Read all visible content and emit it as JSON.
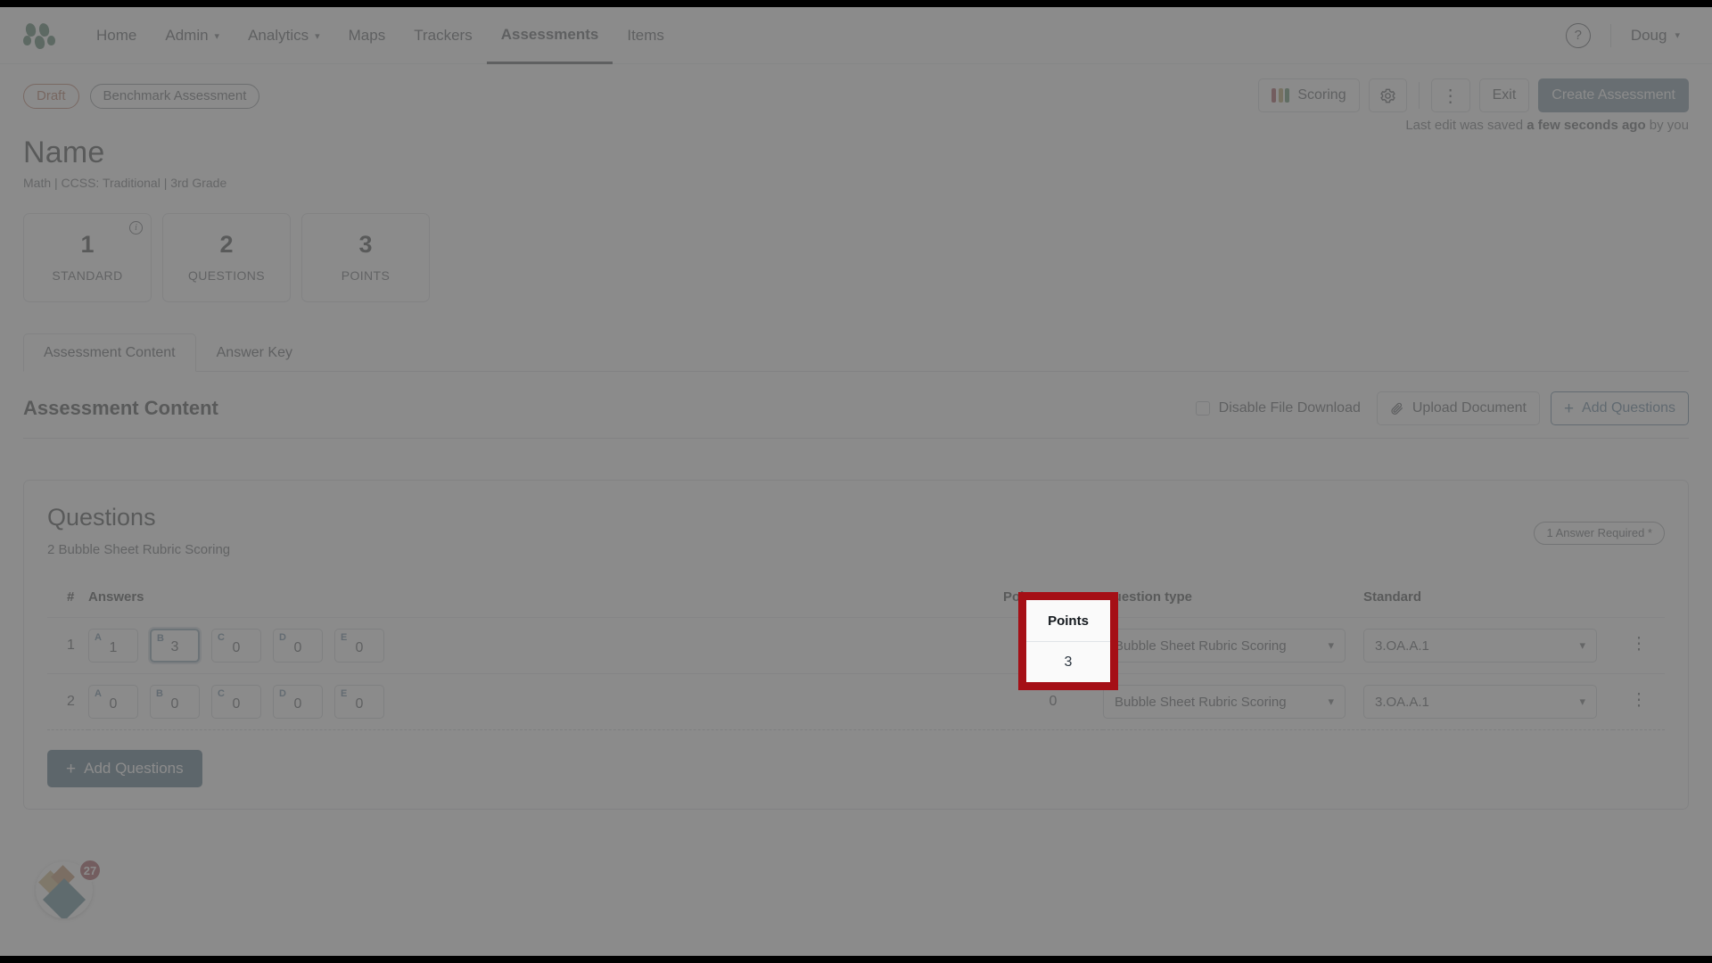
{
  "nav": {
    "logo_icon": "scantron-dots-logo",
    "items": [
      {
        "label": "Home",
        "has_caret": false,
        "active": false
      },
      {
        "label": "Admin",
        "has_caret": true,
        "active": false
      },
      {
        "label": "Analytics",
        "has_caret": true,
        "active": false
      },
      {
        "label": "Maps",
        "has_caret": false,
        "active": false
      },
      {
        "label": "Trackers",
        "has_caret": false,
        "active": false
      },
      {
        "label": "Assessments",
        "has_caret": false,
        "active": true
      },
      {
        "label": "Items",
        "has_caret": false,
        "active": false
      }
    ],
    "help_label": "?",
    "user_label": "Doug",
    "caret_glyph": "⌄"
  },
  "header": {
    "status_chip": "Draft",
    "type_chip": "Benchmark Assessment",
    "title": "Name",
    "subtitle": "Math  |  CCSS: Traditional  |  3rd Grade",
    "saved_prefix": "Last edit was saved ",
    "saved_strong": "a few seconds ago",
    "saved_suffix": " by you",
    "actions": {
      "scoring_label": "Scoring",
      "settings_icon": "gear-icon",
      "kebab_icon": "vertical-dots-icon",
      "exit_label": "Exit",
      "create_label": "Create Assessment"
    },
    "scoring_colors": [
      "#c01928",
      "#b3880f",
      "#1b7a33"
    ]
  },
  "stats": [
    {
      "number": "1",
      "label": "STANDARD",
      "info": true
    },
    {
      "number": "2",
      "label": "QUESTIONS",
      "info": false
    },
    {
      "number": "3",
      "label": "POINTS",
      "info": false
    }
  ],
  "tabs": [
    {
      "label": "Assessment Content",
      "active": true
    },
    {
      "label": "Answer Key",
      "active": false
    }
  ],
  "section": {
    "title": "Assessment Content",
    "disable_download_label": "Disable File Download",
    "disable_download_checked": false,
    "upload_label": "Upload Document",
    "upload_icon": "paperclip-icon",
    "add_questions_label": "Add Questions",
    "plus_icon": "plus-icon"
  },
  "questions_card": {
    "title": "Questions",
    "subtitle": "2 Bubble Sheet Rubric Scoring",
    "requirement_badge": "1 Answer Required *",
    "columns": {
      "number": "#",
      "answers": "Answers",
      "points": "Points",
      "question_type": "Question type",
      "standard": "Standard"
    },
    "rows": [
      {
        "number": "1",
        "answers": [
          {
            "letter": "A",
            "value": "1",
            "focused": false
          },
          {
            "letter": "B",
            "value": "3",
            "focused": true
          },
          {
            "letter": "C",
            "value": "0",
            "focused": false
          },
          {
            "letter": "D",
            "value": "0",
            "focused": false
          },
          {
            "letter": "E",
            "value": "0",
            "focused": false
          }
        ],
        "points": "3",
        "question_type": "Bubble Sheet Rubric Scoring",
        "standard": "3.OA.A.1",
        "menu_icon": "vertical-dots-icon"
      },
      {
        "number": "2",
        "answers": [
          {
            "letter": "A",
            "value": "0",
            "focused": false
          },
          {
            "letter": "B",
            "value": "0",
            "focused": false
          },
          {
            "letter": "C",
            "value": "0",
            "focused": false
          },
          {
            "letter": "D",
            "value": "0",
            "focused": false
          },
          {
            "letter": "E",
            "value": "0",
            "focused": false
          }
        ],
        "points": "0",
        "question_type": "Bubble Sheet Rubric Scoring",
        "standard": "3.OA.A.1",
        "menu_icon": "vertical-dots-icon"
      }
    ],
    "add_button_label": "Add Questions"
  },
  "widget": {
    "badge_count": "27",
    "icon": "pendo-resource-center-icon"
  },
  "annotation": {
    "highlight_color": "#a50f16",
    "target_column_header": "Points",
    "target_value": "3"
  }
}
